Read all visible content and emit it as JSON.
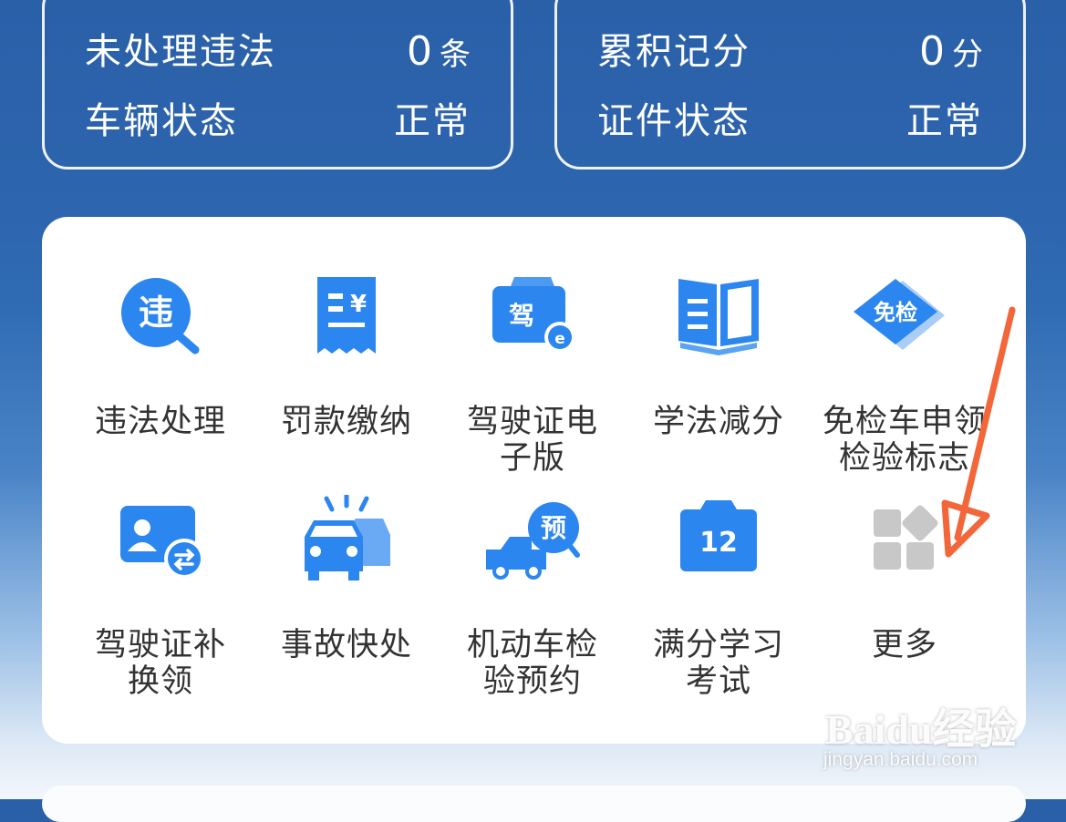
{
  "stats": {
    "left": {
      "row1": {
        "label": "未处理违法",
        "value": "0",
        "unit": "条"
      },
      "row2": {
        "label": "车辆状态",
        "value": "正常"
      }
    },
    "right": {
      "row1": {
        "label": "累积记分",
        "value": "0",
        "unit": "分"
      },
      "row2": {
        "label": "证件状态",
        "value": "正常"
      }
    }
  },
  "services": [
    {
      "label_line1": "违法处理",
      "label_line2": "",
      "icon": "violation-search-icon",
      "icon_text": "违"
    },
    {
      "label_line1": "罚款缴纳",
      "label_line2": "",
      "icon": "fine-receipt-icon",
      "icon_text": "¥"
    },
    {
      "label_line1": "驾驶证电",
      "label_line2": "子版",
      "icon": "e-license-icon",
      "icon_text": "驾"
    },
    {
      "label_line1": "学法减分",
      "label_line2": "",
      "icon": "book-icon",
      "icon_text": ""
    },
    {
      "label_line1": "免检车申领",
      "label_line2": "检验标志",
      "icon": "inspection-exempt-icon",
      "icon_text": "免检"
    },
    {
      "label_line1": "驾驶证补",
      "label_line2": "换领",
      "icon": "license-replace-icon",
      "icon_text": ""
    },
    {
      "label_line1": "事故快处",
      "label_line2": "",
      "icon": "accident-cars-icon",
      "icon_text": ""
    },
    {
      "label_line1": "机动车检",
      "label_line2": "验预约",
      "icon": "truck-booking-icon",
      "icon_text": "预"
    },
    {
      "label_line1": "满分学习",
      "label_line2": "考试",
      "icon": "calendar-12-icon",
      "icon_text": "12"
    },
    {
      "label_line1": "更多",
      "label_line2": "",
      "icon": "more-grid-icon",
      "icon_text": ""
    }
  ],
  "watermark": {
    "brand": "Baidu经验",
    "url": "jingyan.baidu.com"
  },
  "colors": {
    "header_blue": "#2a60a8",
    "icon_blue": "#2b86ef",
    "arrow": "#f2663a",
    "more_gray": "#c8c8c8"
  }
}
